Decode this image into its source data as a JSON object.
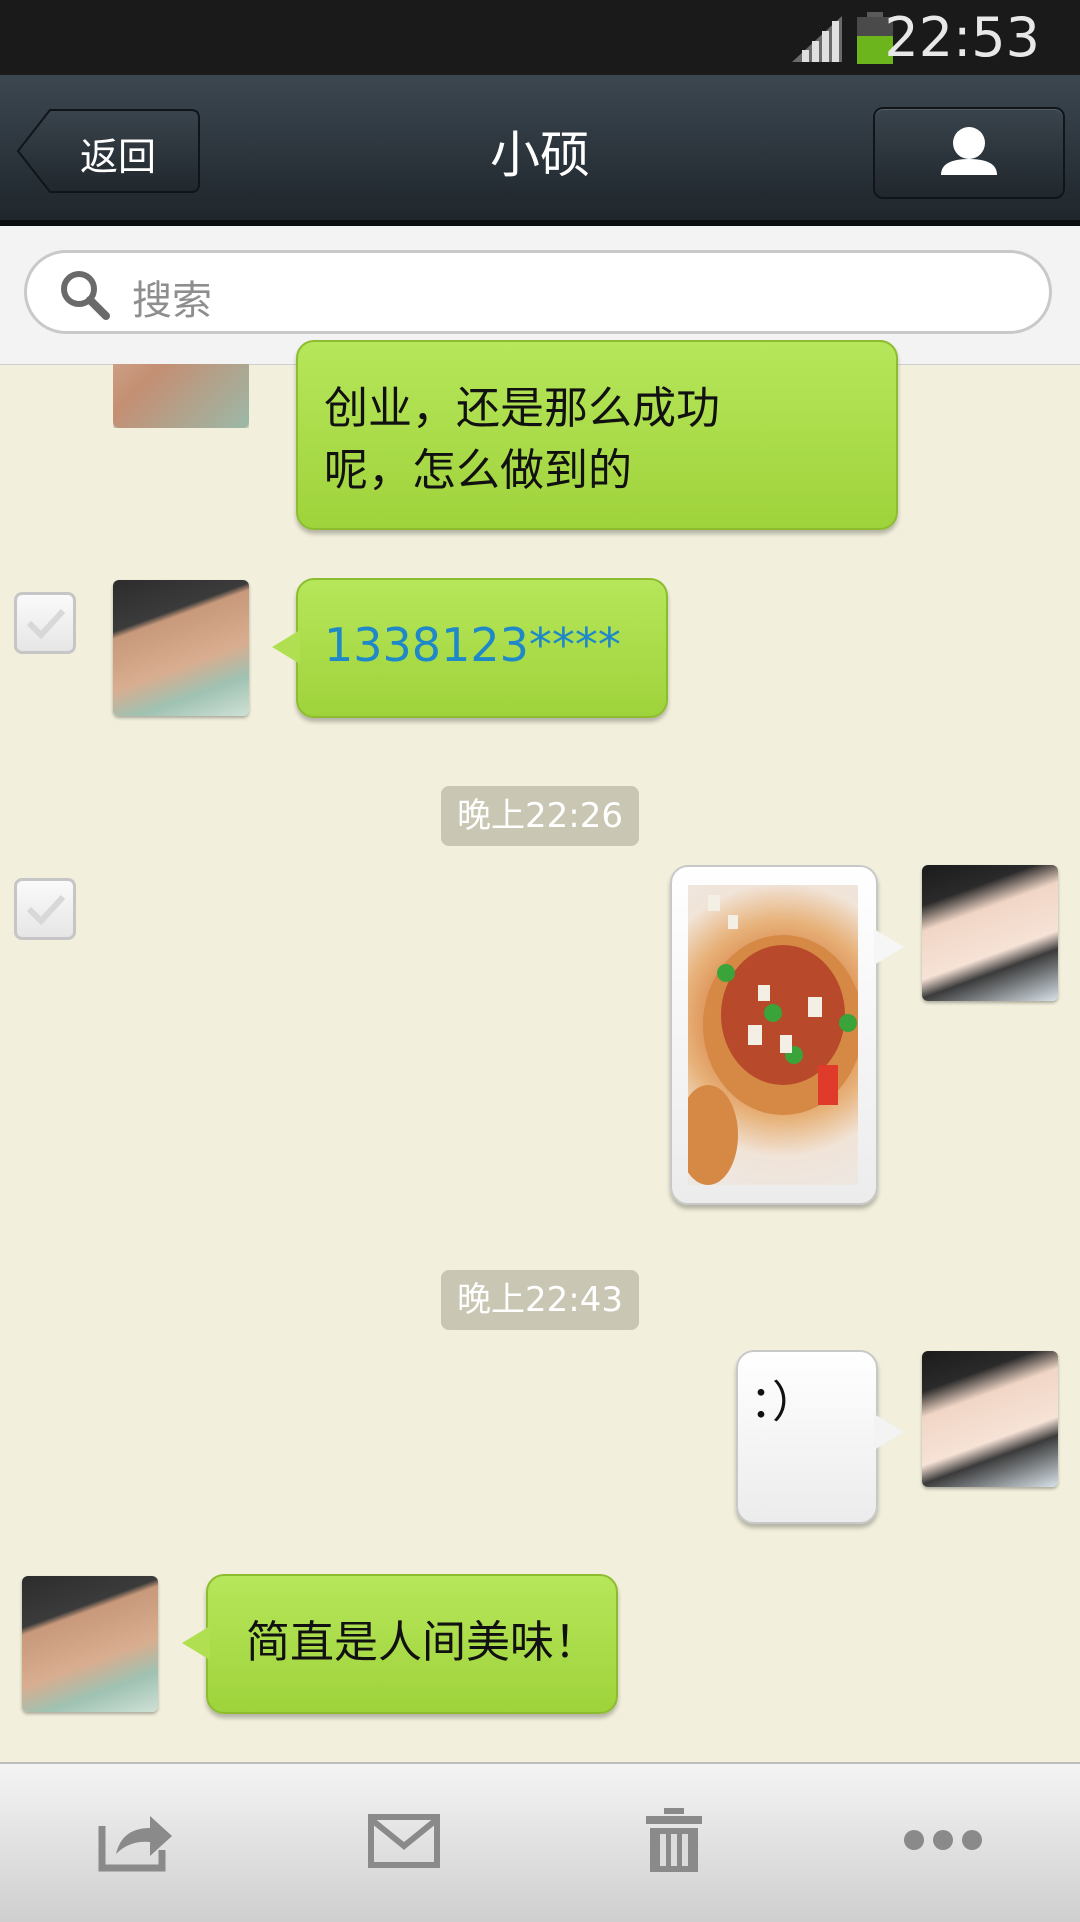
{
  "status_bar": {
    "time": "22:53"
  },
  "nav": {
    "back_label": "返回",
    "title": "小硕"
  },
  "search": {
    "placeholder": "搜索"
  },
  "messages": [
    {
      "text": "创业，还是那么成功\n呢，怎么做到的"
    },
    {
      "text": "1338123****"
    },
    {
      "time": "晚上22:26"
    },
    {
      "time": "晚上22:43"
    },
    {
      "text": "：）"
    },
    {
      "text": "简直是人间美味！"
    }
  ],
  "toolbar": {
    "icons": [
      "share-icon",
      "mail-icon",
      "trash-icon",
      "more-icon"
    ]
  },
  "colors": {
    "chat_background": "#f2f0dc",
    "bubble_green": "#a8da46",
    "link_blue": "#1e88c8",
    "battery_green": "#6cb51c"
  }
}
